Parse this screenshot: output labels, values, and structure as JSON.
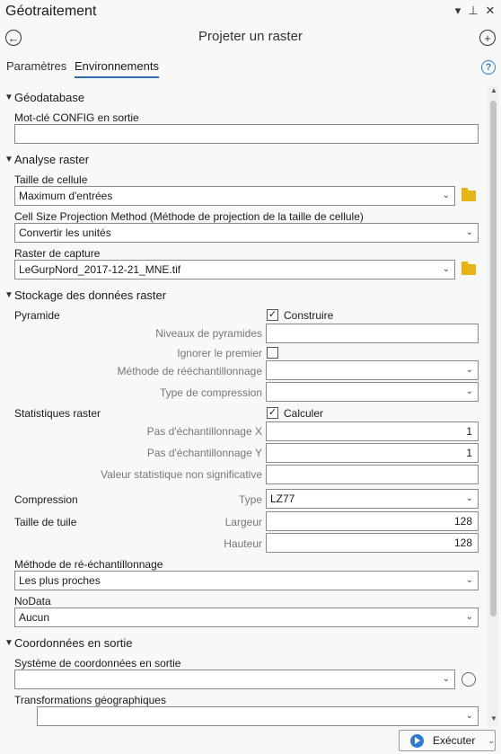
{
  "window": {
    "title": "Géotraitement"
  },
  "tool": {
    "title": "Projeter un raster"
  },
  "tabs": [
    {
      "label": "Paramètres"
    },
    {
      "label": "Environnements"
    }
  ],
  "help_label": "?",
  "geodb": {
    "title": "Géodatabase",
    "config_label": "Mot-clé CONFIG en sortie",
    "config_value": ""
  },
  "raster_analysis": {
    "title": "Analyse raster",
    "cell_size_label": "Taille de cellule",
    "cell_size_value": "Maximum d'entrées",
    "projection_label": "Cell Size Projection Method (Méthode de projection de la taille de cellule)",
    "projection_value": "Convertir les unités",
    "snap_label": "Raster de capture",
    "snap_value": "LeGurpNord_2017-12-21_MNE.tif"
  },
  "raster_storage": {
    "title": "Stockage des données raster",
    "pyramid_label": "Pyramide",
    "build_label": "Construire",
    "build_checked": true,
    "pyramid_levels_label": "Niveaux de pyramides",
    "pyramid_levels_value": "",
    "skip_first_label": "Ignorer le premier",
    "skip_first_checked": false,
    "resampling_label": "Méthode de rééchantillonnage",
    "resampling_value": "",
    "compression_type_label": "Type de compression",
    "compression_type_value": "",
    "stats_label": "Statistiques raster",
    "calc_label": "Calculer",
    "calc_checked": true,
    "skip_x_label": "Pas d'échantillonnage X",
    "skip_x_value": "1",
    "skip_y_label": "Pas d'échantillonnage Y",
    "skip_y_value": "1",
    "ignore_value_label": "Valeur statistique non significative",
    "ignore_value_value": "",
    "compression_label": "Compression",
    "type_label": "Type",
    "type_value": "LZ77",
    "tile_label": "Taille de tuile",
    "width_label": "Largeur",
    "width_value": "128",
    "height_label": "Hauteur",
    "height_value": "128",
    "resample_method_label": "Méthode de ré-échantillonnage",
    "resample_method_value": "Les plus proches",
    "nodata_label": "NoData",
    "nodata_value": "Aucun"
  },
  "output_coords": {
    "title": "Coordonnées en sortie",
    "cs_label": "Système de coordonnées en sortie",
    "cs_value": "",
    "geo_transform_label": "Transformations géographiques",
    "geo_transform_value": ""
  },
  "run": {
    "label": "Exécuter"
  }
}
